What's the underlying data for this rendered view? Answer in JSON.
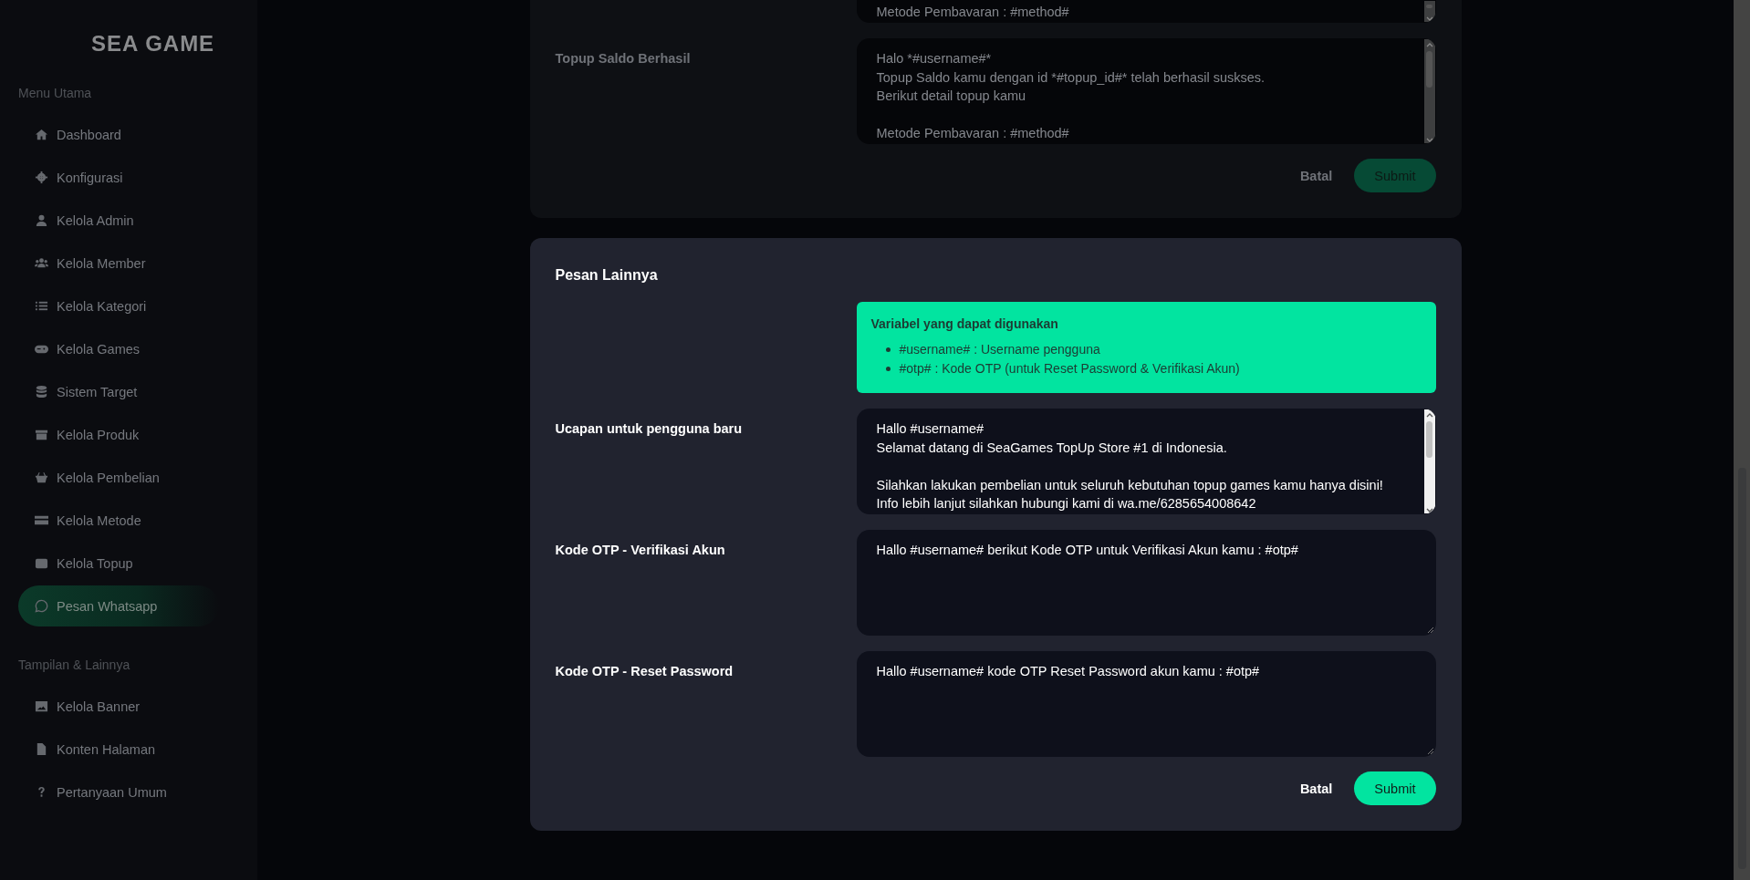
{
  "sidebar": {
    "logo": "SEA GAME",
    "sections": [
      {
        "title": "Menu Utama",
        "items": [
          {
            "label": "Dashboard",
            "selected": false
          },
          {
            "label": "Konfigurasi",
            "selected": false
          },
          {
            "label": "Kelola Admin",
            "selected": false
          },
          {
            "label": "Kelola Member",
            "selected": false
          },
          {
            "label": "Kelola Kategori",
            "selected": false
          },
          {
            "label": "Kelola Games",
            "selected": false
          },
          {
            "label": "Sistem Target",
            "selected": false
          },
          {
            "label": "Kelola Produk",
            "selected": false
          },
          {
            "label": "Kelola Pembelian",
            "selected": false
          },
          {
            "label": "Kelola Metode",
            "selected": false
          },
          {
            "label": "Kelola Topup",
            "selected": false
          },
          {
            "label": "Pesan Whatsapp",
            "selected": true
          }
        ]
      },
      {
        "title": "Tampilan & Lainnya",
        "items": [
          {
            "label": "Kelola Banner",
            "selected": false
          },
          {
            "label": "Konten Halaman",
            "selected": false
          },
          {
            "label": "Pertanyaan Umum",
            "selected": false
          }
        ]
      }
    ]
  },
  "cards": [
    {
      "dimmed": true,
      "fields": [
        {
          "value": "Metode Pembavaran : #method#",
          "scrollbar": true
        },
        {
          "label": "Topup Saldo Berhasil",
          "value": "Halo *#username#*\nTopup Saldo kamu dengan id *#topup_id#* telah berhasil suskses.\nBerikut detail topup kamu\n\nMetode Pembavaran : #method#",
          "scrollbar": true
        }
      ],
      "cancel": "Batal",
      "submit": "Submit"
    },
    {
      "dimmed": false,
      "title": "Pesan Lainnya",
      "notice": {
        "title": "Variabel yang dapat digunakan",
        "items": [
          "#username# : Username pengguna",
          "#otp# : Kode OTP (untuk Reset Password & Verifikasi Akun)"
        ]
      },
      "fields": [
        {
          "label": "Ucapan untuk pengguna baru",
          "value": "Hallo #username#\nSelamat datang di SeaGames TopUp Store #1 di Indonesia.\n\nSilahkan lakukan pembelian untuk seluruh kebutuhan topup games kamu hanya disini!\nInfo lebih lanjut silahkan hubungi kami di wa.me/6285654008642",
          "scrollbar": true
        },
        {
          "label": "Kode OTP - Verifikasi Akun",
          "value": "Hallo #username# berikut Kode OTP untuk Verifikasi Akun kamu : #otp#",
          "scrollbar": false
        },
        {
          "label": "Kode OTP - Reset Password",
          "value": "Hallo #username# kode OTP Reset Password akun kamu : #otp#",
          "scrollbar": false
        }
      ],
      "cancel": "Batal",
      "submit": "Submit"
    }
  ]
}
